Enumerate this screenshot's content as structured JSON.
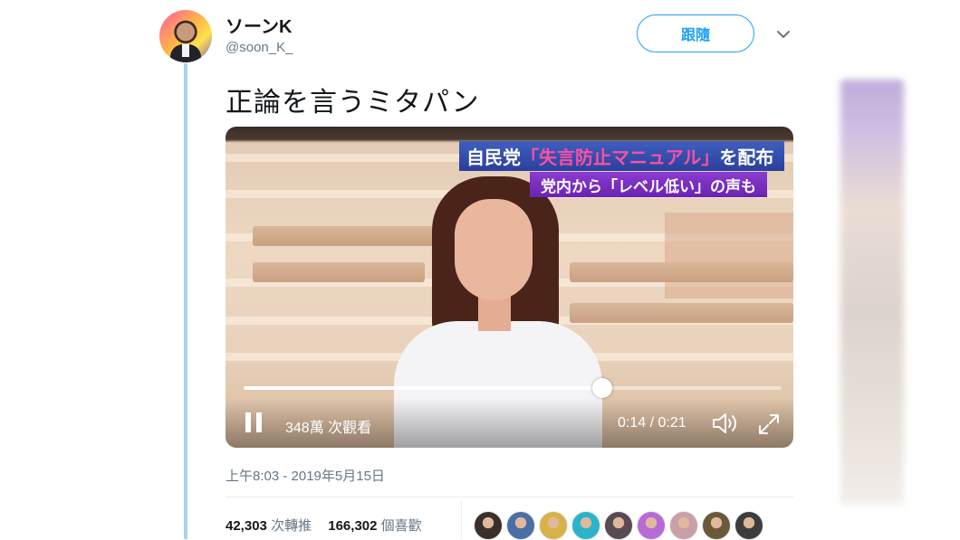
{
  "tweet": {
    "display_name": "ソーンK",
    "handle": "@soon_K_",
    "follow_label": "跟隨",
    "text": "正論を言うミタパン",
    "timestamp": "上午8:03 - 2019年5月15日"
  },
  "video": {
    "caption_line1_prefix": "自民党",
    "caption_line1_highlight": "「失言防止マニュアル」",
    "caption_line1_suffix": "を配布",
    "caption_line2": "党内から「レベル低い」の声も",
    "views": "348萬 次觀看",
    "time": "0:14 / 0:21",
    "progress": 0.666
  },
  "stats": {
    "retweets_count": "42,303",
    "retweets_label": "次轉推",
    "likes_count": "166,302",
    "likes_label": "個喜歡"
  },
  "likers": [
    {
      "name": "liker-1",
      "color": "#3a2f2a"
    },
    {
      "name": "liker-2",
      "color": "#4a6fa5"
    },
    {
      "name": "liker-3",
      "color": "#d8b14a"
    },
    {
      "name": "liker-4",
      "color": "#2bb3c9"
    },
    {
      "name": "liker-5",
      "color": "#5a4a52"
    },
    {
      "name": "liker-6",
      "color": "#b86bd6"
    },
    {
      "name": "liker-7",
      "color": "#c9a0a8"
    },
    {
      "name": "liker-8",
      "color": "#6b5a3a"
    },
    {
      "name": "liker-9",
      "color": "#3d3d3d"
    }
  ],
  "colors": {
    "accent": "#1da1f2",
    "thread_line": "#a8d3f0",
    "secondary_text": "#657786"
  }
}
